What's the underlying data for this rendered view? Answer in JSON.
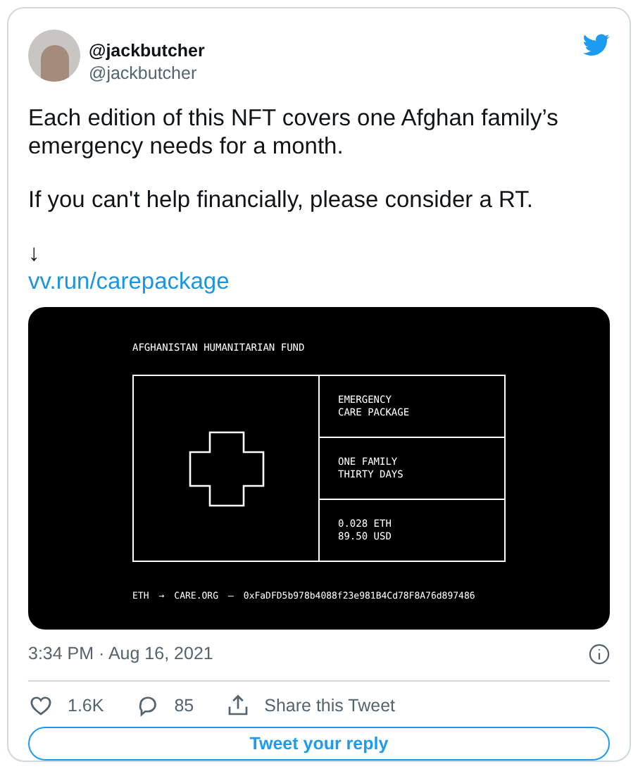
{
  "author": {
    "name": "@jackbutcher",
    "handle": "@jackbutcher"
  },
  "body": {
    "paragraphs": [
      "Each edition of this NFT covers one Afghan family’s emergency needs for a month.",
      "If you can't help financially, please consider a RT."
    ],
    "arrow": "↓",
    "link": "vv.run/carepackage"
  },
  "artwork": {
    "title": "AFGHANISTAN HUMANITARIAN FUND",
    "panels": [
      [
        "EMERGENCY",
        "CARE PACKAGE"
      ],
      [
        "ONE FAMILY",
        "THIRTY DAYS"
      ],
      [
        "0.028 ETH",
        "89.50 USD"
      ]
    ],
    "footer": [
      "ETH",
      "→",
      "CARE.ORG",
      "—",
      "0xFaDFD5b978b4088f23e981B4Cd78F8A76d897486"
    ]
  },
  "timestamp": "3:34 PM · Aug 16, 2021",
  "actions": [
    {
      "kind": "like",
      "label": "1.6K"
    },
    {
      "kind": "reply",
      "label": "85"
    },
    {
      "kind": "share",
      "label": "Share this Tweet"
    }
  ],
  "reply_button": "Tweet your reply"
}
